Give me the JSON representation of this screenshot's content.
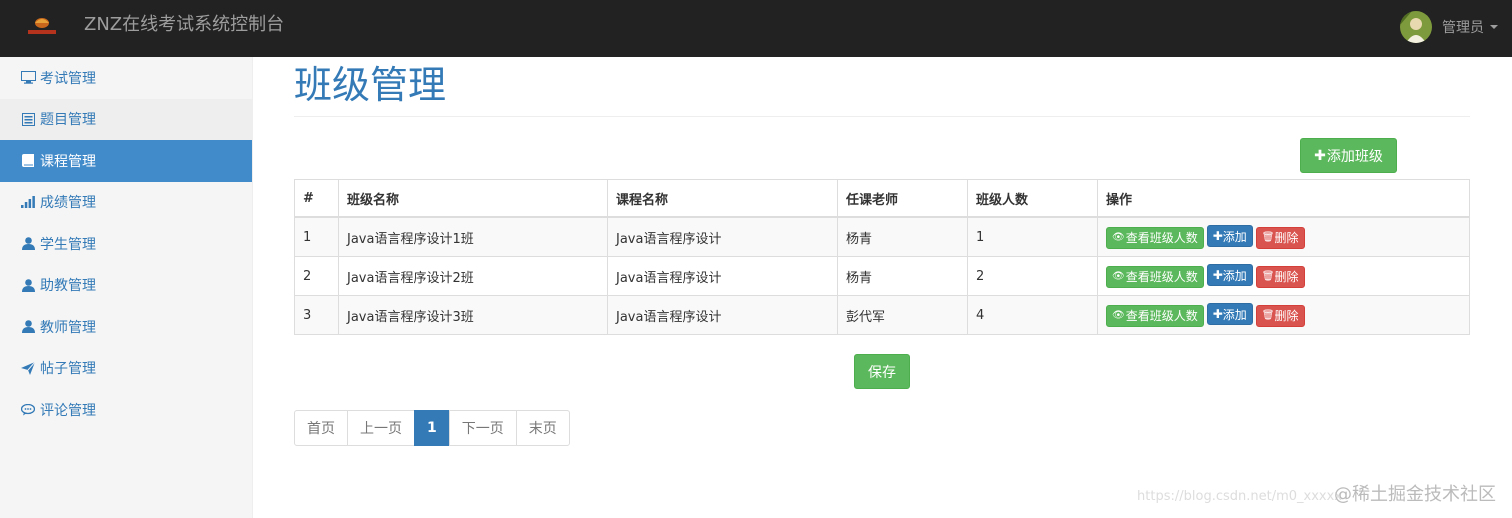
{
  "app": {
    "brand": "ZNZ在线考试系统控制台"
  },
  "user": {
    "name": "管理员"
  },
  "sidebar": {
    "items": [
      {
        "label": "考试管理",
        "icon": "monitor-icon"
      },
      {
        "label": "题目管理",
        "icon": "list-alt-icon"
      },
      {
        "label": "课程管理",
        "icon": "book-icon"
      },
      {
        "label": "成绩管理",
        "icon": "signal-icon"
      },
      {
        "label": "学生管理",
        "icon": "user-icon"
      },
      {
        "label": "助教管理",
        "icon": "user-icon"
      },
      {
        "label": "教师管理",
        "icon": "user-icon"
      },
      {
        "label": "帖子管理",
        "icon": "send-icon"
      },
      {
        "label": "评论管理",
        "icon": "comment-icon"
      }
    ],
    "active_index": 2
  },
  "page": {
    "title": "班级管理",
    "add_button": "添加班级",
    "save_button": "保存"
  },
  "table": {
    "headers": [
      "#",
      "班级名称",
      "课程名称",
      "任课老师",
      "班级人数",
      "操作"
    ],
    "rows": [
      {
        "no": "1",
        "class_name": "Java语言程序设计1班",
        "course": "Java语言程序设计",
        "teacher": "杨青",
        "count": "1"
      },
      {
        "no": "2",
        "class_name": "Java语言程序设计2班",
        "course": "Java语言程序设计",
        "teacher": "杨青",
        "count": "2"
      },
      {
        "no": "3",
        "class_name": "Java语言程序设计3班",
        "course": "Java语言程序设计",
        "teacher": "彭代军",
        "count": "4"
      }
    ],
    "actions": {
      "view": "查看班级人数",
      "add": "添加",
      "delete": "删除"
    }
  },
  "pagination": {
    "first": "首页",
    "prev": "上一页",
    "current": "1",
    "next": "下一页",
    "last": "末页"
  },
  "watermark": {
    "text": "@稀土掘金技术社区",
    "url": "https://blog.csdn.net/m0_xxxxx"
  },
  "colors": {
    "navbar": "#222222",
    "primary": "#337ab7",
    "success": "#5cb85c",
    "danger": "#d9534f",
    "sidebar_active": "#428bca"
  }
}
